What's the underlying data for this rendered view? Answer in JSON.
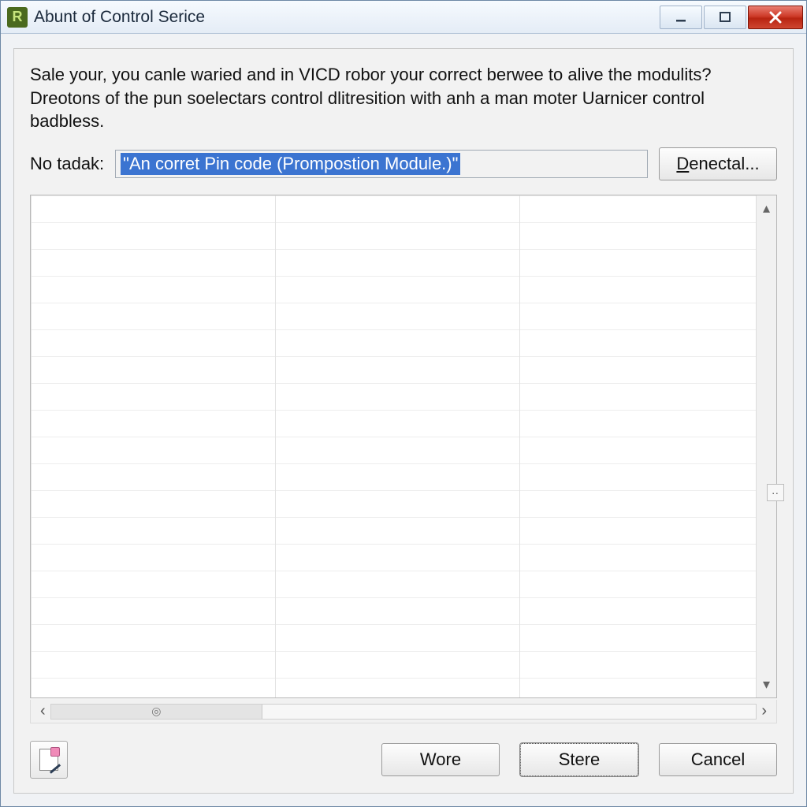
{
  "window": {
    "title": "Abunt of Control Serice",
    "icon_letter": "R"
  },
  "description": "Sale your, you canle waried and in VICD robor your correct berwee to alive the modulits? Dreotons of the pun soelectars control dlitresition with anh a man moter Uarnicer control badbless.",
  "input_row": {
    "label": "No tadak:",
    "value": "\"An corret Pin code (Prompostion Module.)\"",
    "browse_label_pre": "D",
    "browse_label_rest": "enectal..."
  },
  "footer": {
    "wore_label": "Wore",
    "stere_label": "Stere",
    "cancel_label": "Cancel"
  }
}
